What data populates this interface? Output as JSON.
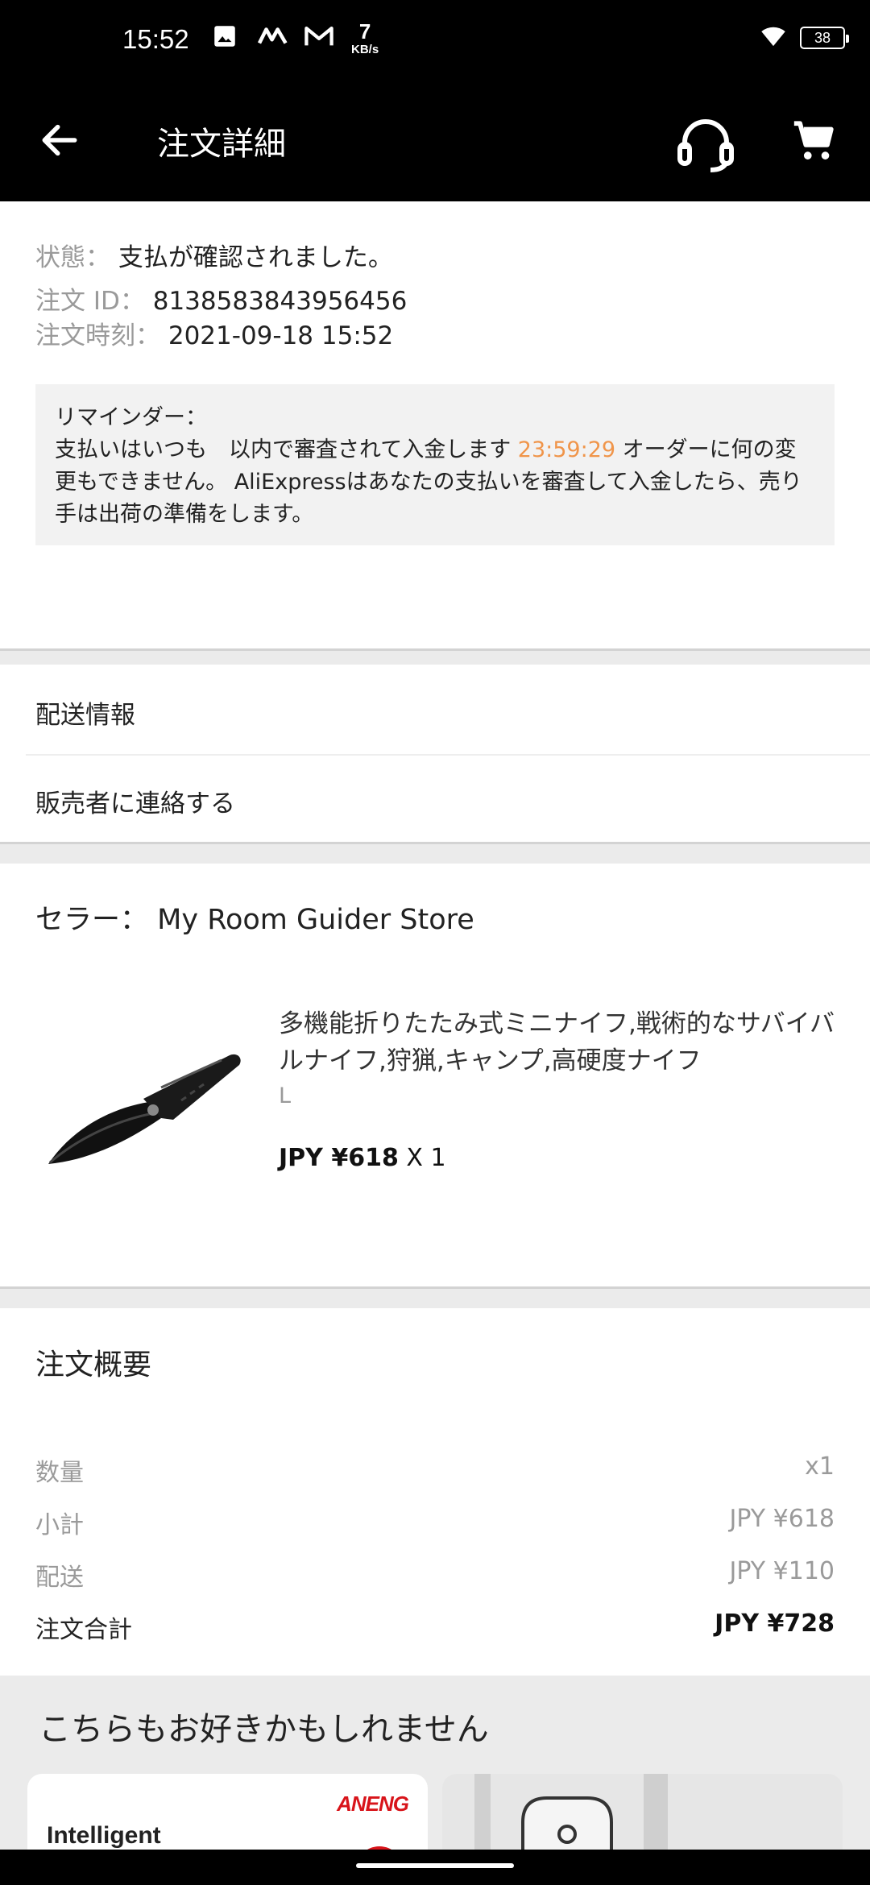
{
  "status_bar": {
    "time": "15:52",
    "net_speed_value": "7",
    "net_speed_unit": "KB/s",
    "battery": "38",
    "icons": [
      "image-icon",
      "app-m-icon",
      "gmail-icon",
      "wifi-icon",
      "battery-icon"
    ]
  },
  "app_bar": {
    "title": "注文詳細",
    "icons": [
      "back-arrow-icon",
      "headset-support-icon",
      "cart-icon"
    ]
  },
  "order": {
    "status_label": "状態：",
    "status_value": "支払が確認されました。",
    "id_label": "注文 ID：",
    "id_value": "8138583843956456",
    "time_label": "注文時刻：",
    "time_value": "2021-09-18 15:52"
  },
  "reminder": {
    "title": "リマインダー：",
    "text_before_timer": "支払いはいつも　以内で審査されて入金します ",
    "timer": "23:59:29",
    "text_after_timer": " オーダーに何の変更もできません。 AliExpressはあなたの支払いを審査して入金したら、売り手は出荷の準備をします。"
  },
  "links": {
    "shipping_info": "配送情報",
    "contact_seller": "販売者に連絡する"
  },
  "seller": {
    "label": "セラー：",
    "name": "My Room Guider Store"
  },
  "product": {
    "title": "多機能折りたたみ式ミニナイフ,戦術的なサバイバルナイフ,狩猟,キャンプ,高硬度ナイフ",
    "variant": "L",
    "price": "JPY ¥618",
    "quantity": "X 1"
  },
  "summary": {
    "title": "注文概要",
    "rows": [
      {
        "label": "数量",
        "value": "x1"
      },
      {
        "label": "小計",
        "value": "JPY ¥618"
      },
      {
        "label": "配送",
        "value": "JPY ¥110"
      }
    ],
    "total_label": "注文合計",
    "total_value": "JPY ¥728"
  },
  "recommend": {
    "title": "こちらもお好きかもしれません",
    "card1_brand": "ANENG",
    "card1_text": "Intelligent"
  },
  "colors": {
    "timer": "#f0954a",
    "brand_red": "#d8141a"
  }
}
